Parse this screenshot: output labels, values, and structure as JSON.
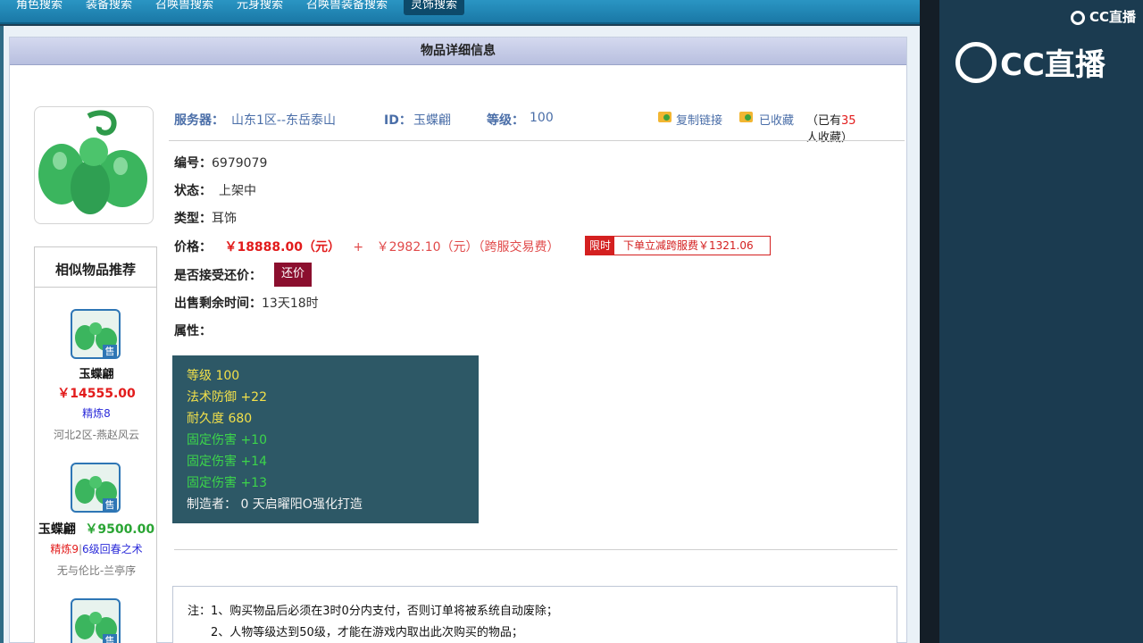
{
  "nav": {
    "tabs": [
      "角色搜索",
      "装备搜索",
      "召唤兽搜索",
      "元身搜索",
      "召唤兽装备搜索",
      "灵饰搜索"
    ],
    "active": "灵饰搜索"
  },
  "panel": {
    "title": "物品详细信息"
  },
  "item": {
    "server_label": "服务器：",
    "server": "山东1区--东岳泰山",
    "id_label": "ID：",
    "id": "玉蝶翩",
    "level_label": "等级：",
    "level": "100",
    "copy_link": "复制链接",
    "favorited": "已收藏",
    "fav_prefix": "（已有",
    "fav_count": "35",
    "fav_suffix": "人收藏）",
    "number_label": "编号：",
    "number": "6979079",
    "status_label": "状态：",
    "status": "上架中",
    "type_label": "类型：",
    "type": "耳饰",
    "price_label": "价格：",
    "price": "￥18888.00（元）",
    "plus": "+",
    "fee": "￥2982.10（元）（跨服交易费）",
    "limit_badge": "限时",
    "limit_text": "下单立减跨服费￥1321.06",
    "bargain_label": "是否接受还价：",
    "bargain_button": "还价",
    "remaining_label": "出售剩余时间：",
    "remaining": "13天18时",
    "attr_label": "属性："
  },
  "attributes": [
    {
      "text": "等级 100",
      "color": "#f2e04a"
    },
    {
      "text": "法术防御 +22",
      "color": "#f2e04a"
    },
    {
      "text": "耐久度 680",
      "color": "#f2e04a"
    },
    {
      "text": "固定伤害 +10",
      "color": "#3cd44a"
    },
    {
      "text": "固定伤害 +14",
      "color": "#3cd44a"
    },
    {
      "text": "固定伤害 +13",
      "color": "#3cd44a"
    },
    {
      "text": "制造者： 0 天启曜阳O强化打造",
      "color": "#f2f2f2"
    }
  ],
  "similar": {
    "title": "相似物品推荐",
    "badge": "售",
    "items": [
      {
        "name": "玉蝶翩",
        "price": "￥14555.00",
        "refine": "精炼8",
        "server": "河北2区-燕赵风云"
      },
      {
        "name": "玉蝶翩",
        "price": "￥9500.00",
        "refine": "精炼9",
        "refine_extra": "6级回春之术",
        "server": "无与伦比-兰亭序"
      }
    ]
  },
  "notes": [
    "注：1、购买物品后必须在3时0分内支付，否则订单将被系统自动废除；",
    "2、人物等级达到50级，才能在游戏内取出此次购买的物品；"
  ],
  "stream": {
    "logo_small": "CC直播",
    "logo_big": "CC直播"
  },
  "colors": {
    "nav": "#1a78a6",
    "accent_red": "#e21b1b",
    "attr_bg": "#2d5866"
  }
}
